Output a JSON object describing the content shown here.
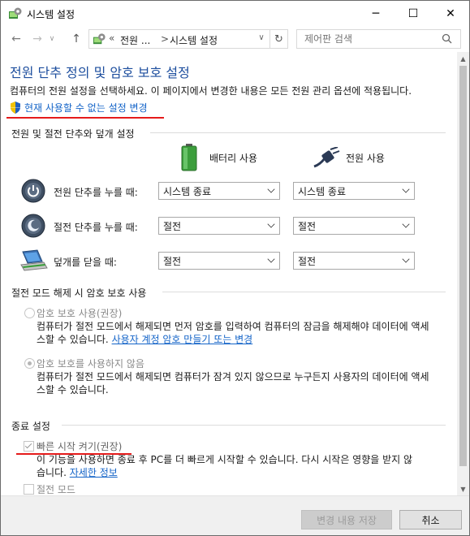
{
  "window": {
    "title": "시스템 설정",
    "controls": {
      "minimize": "─",
      "maximize": "☐",
      "close": "✕"
    }
  },
  "nav": {
    "back": "←",
    "forward": "→",
    "dropdown": "∨",
    "up": "↑",
    "address_chevron": "«",
    "crumbs": [
      "전원 ...",
      "시스템 설정"
    ],
    "separator": ">",
    "address_dropdown": "∨",
    "refresh": "↻",
    "search_placeholder": "제어판 검색",
    "search_icon": "🔍"
  },
  "content": {
    "title": "전원 단추 정의 및 암호 보호 설정",
    "description": "컴퓨터의 전원 설정을 선택하세요. 이 페이지에서 변경한 내용은 모든 전원 관리 옵션에 적용됩니다.",
    "admin_link": "현재 사용할 수 없는 설정 변경",
    "power_section": {
      "header": "전원 및 절전 단추와 덮개 설정",
      "battery_label": "배터리 사용",
      "plugged_label": "전원 사용",
      "rows": [
        {
          "label": "전원 단추를 누를 때:",
          "battery": "시스템 종료",
          "plugged": "시스템 종료",
          "icon": "power-button-icon"
        },
        {
          "label": "절전 단추를 누를 때:",
          "battery": "절전",
          "plugged": "절전",
          "icon": "sleep-button-icon"
        },
        {
          "label": "덮개를 닫을 때:",
          "battery": "절전",
          "plugged": "절전",
          "icon": "laptop-lid-icon"
        }
      ]
    },
    "password_section": {
      "header": "절전 모드 해제 시 암호 보호 사용",
      "options": [
        {
          "label": "암호 보호 사용(권장)",
          "desc": "컴퓨터가 절전 모드에서 해제되면 먼저 암호를 입력하여 컴퓨터의 잠금을 해제해야 데이터에 액세스할 수 있습니다.",
          "link": "사용자 계정 암호 만들기 또는 변경",
          "checked": false
        },
        {
          "label": "암호 보호를 사용하지 않음",
          "desc": "컴퓨터가 절전 모드에서 해제되면 컴퓨터가 잠겨 있지 않으므로 누구든지 사용자의 데이터에 액세스할 수 있습니다.",
          "checked": true
        }
      ]
    },
    "shutdown_section": {
      "header": "종료 설정",
      "fast_startup_label": "빠른 시작 켜기(권장)",
      "fast_startup_desc": "이 기능을 사용하면 종료 후 PC를 더 빠르게 시작할 수 있습니다. 다시 시작은 영향을 받지 않",
      "fast_startup_desc2": "습니다.",
      "fast_startup_link": "자세한 정보",
      "sleep_label": "절전 모드"
    }
  },
  "footer": {
    "save": "변경 내용 저장",
    "cancel": "취소"
  },
  "colors": {
    "title_blue": "#1d4e9e",
    "link_blue": "#1464c8",
    "highlight_red": "#e51b1b"
  }
}
